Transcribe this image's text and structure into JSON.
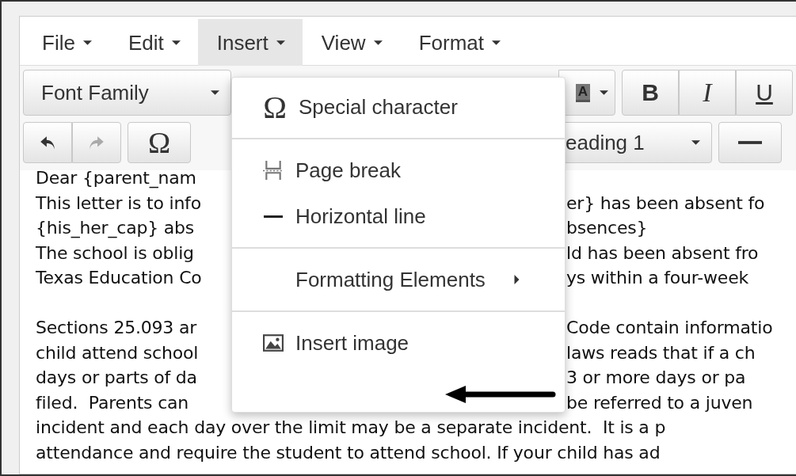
{
  "menubar": [
    {
      "label": "File",
      "selected": false
    },
    {
      "label": "Edit",
      "selected": false
    },
    {
      "label": "Insert",
      "selected": true
    },
    {
      "label": "View",
      "selected": false
    },
    {
      "label": "Format",
      "selected": false
    }
  ],
  "toolbar_row_1": {
    "font_family": "Font Family",
    "text_color": "A",
    "format_buttons": [
      "B",
      "I",
      "U"
    ]
  },
  "toolbar_row_2": {
    "undo": {
      "disabled": false
    },
    "redo": {
      "disabled": true
    },
    "special_char": "Ω",
    "block_format": "eading 1"
  },
  "insert_menu": [
    {
      "kind": "symbol",
      "icon": "Ω",
      "label": "Special character"
    },
    {
      "kind": "divider"
    },
    {
      "kind": "pagebreak",
      "label": "Page break"
    },
    {
      "kind": "rule",
      "label": "Horizontal line"
    },
    {
      "kind": "divider"
    },
    {
      "kind": "submenu",
      "label": "Formatting Elements"
    },
    {
      "kind": "divider"
    },
    {
      "kind": "image",
      "label": "Insert image"
    }
  ],
  "document_paragraphs": [
    {
      "lines": [
        {
          "left": "Dear {parent_nam"
        },
        {
          "left": "This letter is to info",
          "right": "er} has been absent fo"
        },
        {
          "left": "{his_her_cap} abs",
          "right": "bsences}"
        },
        {
          "left": "The school is oblig",
          "right": "ld has been absent fro"
        },
        {
          "left": "Texas Education Co",
          "right": "ys within a four-week"
        }
      ]
    },
    {
      "lines": [
        {
          "left": "Sections 25.093 ar",
          "right": "Code contain informatio"
        },
        {
          "left": "child attend school",
          "right": "laws reads that if a ch"
        },
        {
          "left": "days or parts of da",
          "right": "3 or more days or pa"
        },
        {
          "left": "filed.  Parents can",
          "right": "be referred to a juven"
        },
        {
          "left": "incident and each day over the limit may be a separate incident.  It is a p"
        },
        {
          "left": "attendance and require the student to attend school. If your child has ad"
        }
      ]
    }
  ]
}
